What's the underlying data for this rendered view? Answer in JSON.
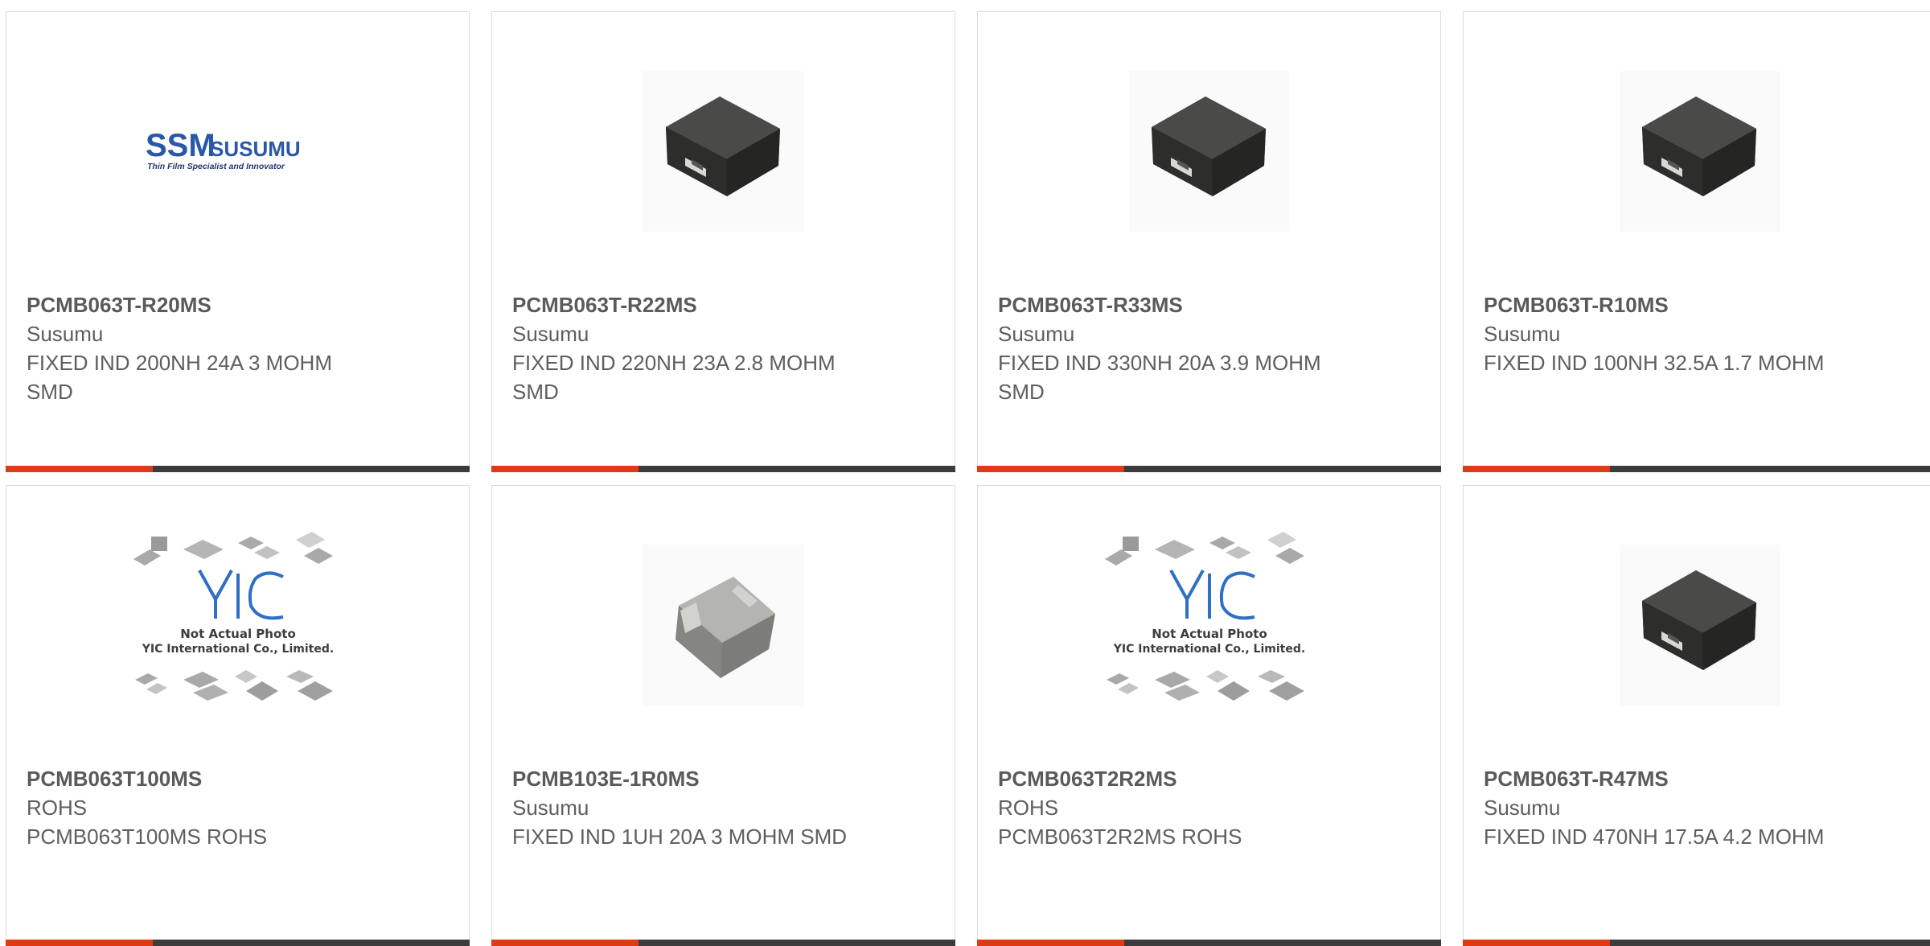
{
  "colors": {
    "accent": "#e03a14",
    "bar": "#3c3c3c",
    "text": "#5e5e5e",
    "border": "#dcdcdc",
    "susumu_blue": "#2a58a8",
    "yic_blue": "#2f6fc4"
  },
  "cards": [
    {
      "part_number": "PCMB063T-R20MS",
      "manufacturer": "Susumu",
      "description": "FIXED IND 200NH 24A 3 MOHM SMD",
      "image": "susumu-logo",
      "logo": {
        "brand": "SSM",
        "name": "SUSUMU",
        "tagline": "Thin Film Specialist and Innovator"
      }
    },
    {
      "part_number": "PCMB063T-R22MS",
      "manufacturer": "Susumu",
      "description": "FIXED IND 220NH 23A 2.8 MOHM SMD",
      "image": "inductor-dark"
    },
    {
      "part_number": "PCMB063T-R33MS",
      "manufacturer": "Susumu",
      "description": "FIXED IND 330NH 20A 3.9 MOHM SMD",
      "image": "inductor-dark"
    },
    {
      "part_number": "PCMB063T-R10MS",
      "manufacturer": "Susumu",
      "description": "FIXED IND 100NH 32.5A 1.7 MOHM",
      "image": "inductor-dark"
    },
    {
      "part_number": "PCMB063T100MS",
      "manufacturer": "ROHS",
      "description": "PCMB063T100MS ROHS",
      "image": "not-actual-photo",
      "placeholder": {
        "logo": "YIC",
        "line1": "Not Actual Photo",
        "line2": "YIC International Co., Limited."
      }
    },
    {
      "part_number": "PCMB103E-1R0MS",
      "manufacturer": "Susumu",
      "description": "FIXED IND 1UH 20A 3 MOHM SMD",
      "image": "inductor-silver"
    },
    {
      "part_number": "PCMB063T2R2MS",
      "manufacturer": "ROHS",
      "description": "PCMB063T2R2MS ROHS",
      "image": "not-actual-photo",
      "placeholder": {
        "logo": "YIC",
        "line1": "Not Actual Photo",
        "line2": "YIC International Co., Limited."
      }
    },
    {
      "part_number": "PCMB063T-R47MS",
      "manufacturer": "Susumu",
      "description": "FIXED IND 470NH 17.5A 4.2 MOHM",
      "image": "inductor-dark"
    }
  ]
}
